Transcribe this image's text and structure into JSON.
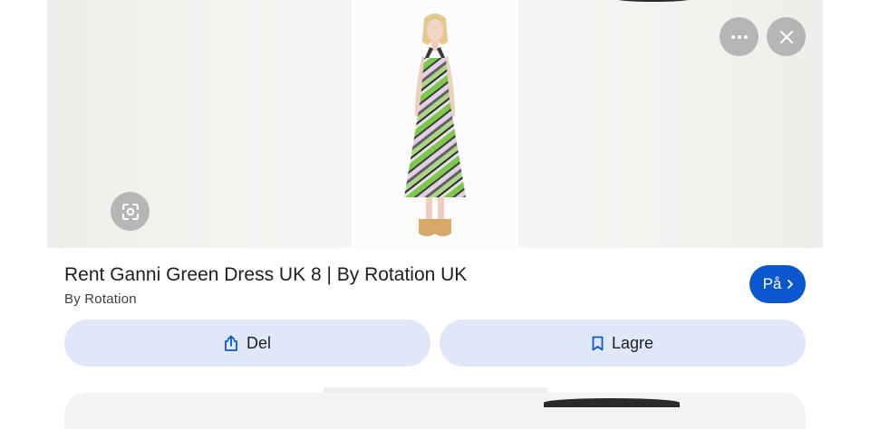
{
  "product": {
    "title": "Rent Ganni Green Dress UK 8 | By Rotation UK",
    "source": "By Rotation"
  },
  "buttons": {
    "visit_label": "På",
    "share_label": "Del",
    "save_label": "Lagre"
  },
  "icons": {
    "lens": "google-lens-icon",
    "more": "more-horizontal-icon",
    "close": "close-icon",
    "visit": "chevron-right-icon",
    "share": "share-icon",
    "save": "bookmark-icon"
  },
  "colors": {
    "accent": "#0b57d0",
    "action_button_bg": "#dfe7f8"
  }
}
